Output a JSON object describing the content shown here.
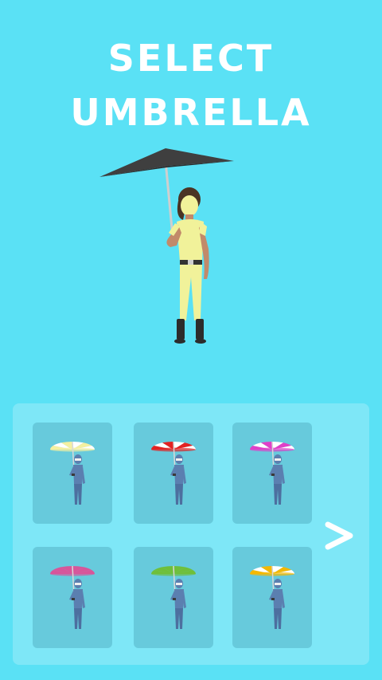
{
  "screen": {
    "title_line1": "SELECT",
    "title_line2": "UMBRELLA",
    "background_color": "#5ae1f5"
  },
  "hero": {
    "umbrella_color": "#3f3f3f"
  },
  "umbrellas": [
    {
      "canopy_primary": "#f4f0a0",
      "canopy_secondary": "#ffffff",
      "pattern": "striped"
    },
    {
      "canopy_primary": "#e32222",
      "canopy_secondary": "#ffffff",
      "pattern": "striped"
    },
    {
      "canopy_primary": "#e040c8",
      "canopy_secondary": "#ffffff",
      "pattern": "striped"
    },
    {
      "canopy_primary": "#d8559a",
      "canopy_secondary": "#d8559a",
      "pattern": "solid"
    },
    {
      "canopy_primary": "#6fbf3a",
      "canopy_secondary": "#6fbf3a",
      "pattern": "solid"
    },
    {
      "canopy_primary": "#f5b800",
      "canopy_secondary": "#ffffff",
      "pattern": "striped"
    }
  ],
  "navigation": {
    "next_icon": "chevron-right-icon"
  }
}
